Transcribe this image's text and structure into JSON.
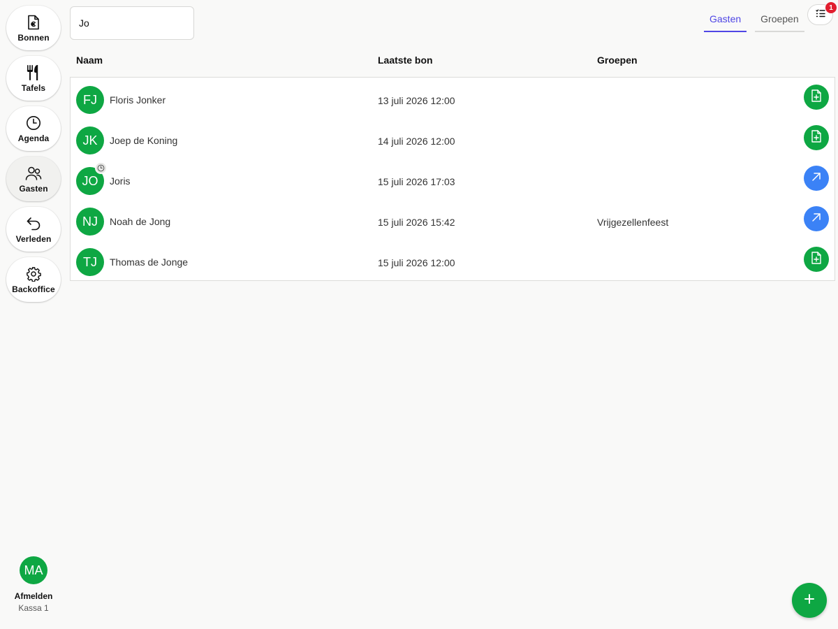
{
  "sidebar": {
    "items": [
      {
        "label": "Bonnen",
        "icon": "receipt-euro-icon"
      },
      {
        "label": "Tafels",
        "icon": "fork-knife-icon"
      },
      {
        "label": "Agenda",
        "icon": "clock-icon"
      },
      {
        "label": "Gasten",
        "icon": "users-icon",
        "active": true
      },
      {
        "label": "Verleden",
        "icon": "undo-arrow-icon"
      },
      {
        "label": "Backoffice",
        "icon": "gear-icon"
      }
    ],
    "user": {
      "initials": "MA",
      "logout_label": "Afmelden",
      "register": "Kassa 1"
    }
  },
  "search": {
    "value": "Jo"
  },
  "tabs": [
    {
      "label": "Gasten",
      "active": true
    },
    {
      "label": "Groepen",
      "active": false
    }
  ],
  "filter": {
    "icon": "list-filter-icon",
    "badge": "1"
  },
  "table": {
    "headers": {
      "name": "Naam",
      "last_receipt": "Laatste bon",
      "groups": "Groepen"
    },
    "rows": [
      {
        "initials": "FJ",
        "name": "Floris Jonker",
        "date": "13 juli 2026 12:00",
        "group": "",
        "action": "new-receipt",
        "action_color": "green",
        "pending": false
      },
      {
        "initials": "JK",
        "name": "Joep de Koning",
        "date": "14 juli 2026 12:00",
        "group": "",
        "action": "new-receipt",
        "action_color": "green",
        "pending": false
      },
      {
        "initials": "JO",
        "name": "Joris",
        "date": "15 juli 2026 17:03",
        "group": "",
        "action": "open-receipt",
        "action_color": "blue",
        "pending": true
      },
      {
        "initials": "NJ",
        "name": "Noah de Jong",
        "date": "15 juli 2026 15:42",
        "group": "Vrijgezellenfeest",
        "action": "open-receipt",
        "action_color": "blue",
        "pending": false
      },
      {
        "initials": "TJ",
        "name": "Thomas de Jonge",
        "date": "15 juli 2026 12:00",
        "group": "",
        "action": "new-receipt",
        "action_color": "green",
        "pending": false
      }
    ]
  },
  "colors": {
    "accent": "#4f46e5",
    "green": "#0ea743",
    "blue": "#3b82f6",
    "badge": "#e11d2e"
  }
}
